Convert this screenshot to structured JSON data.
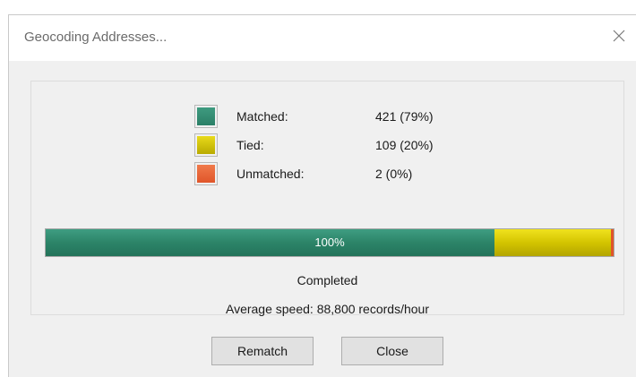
{
  "window": {
    "title": "Geocoding Addresses..."
  },
  "legend": [
    {
      "label": "Matched:",
      "value": "421 (79%)",
      "color": "#2e8a70"
    },
    {
      "label": "Tied:",
      "value": "109 (20%)",
      "color": "#d9c800"
    },
    {
      "label": "Unmatched:",
      "value": "2 (0%)",
      "color": "#e8663a"
    }
  ],
  "progress": {
    "label": "100%",
    "percent_complete": 100,
    "matched_fraction": 0.79,
    "tied_fraction": 0.205,
    "unmatched_fraction": 0.005
  },
  "status": {
    "state": "Completed",
    "speed": "Average speed: 88,800 records/hour"
  },
  "buttons": {
    "rematch": "Rematch",
    "close": "Close"
  },
  "icons": {
    "window_close": "close-icon"
  }
}
